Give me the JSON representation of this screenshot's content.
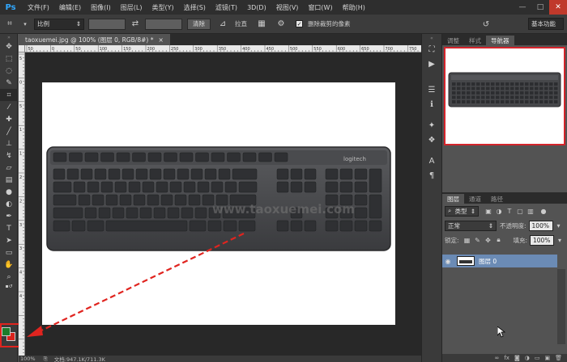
{
  "app": {
    "logo": "Ps"
  },
  "menu": [
    "文件(F)",
    "编辑(E)",
    "图像(I)",
    "图层(L)",
    "类型(Y)",
    "选择(S)",
    "滤镜(T)",
    "3D(D)",
    "视图(V)",
    "窗口(W)",
    "帮助(H)"
  ],
  "window_controls": {
    "minimize": "—",
    "maximize": "□",
    "close": "✕"
  },
  "options": {
    "ratio_label": "比例",
    "clear_label": "清除",
    "straighten_label": "拉直",
    "delete_cropped_label": "删除裁剪的像素",
    "delete_cropped_checked": true,
    "workspace_label": "基本功能"
  },
  "document": {
    "tab_title": "taoxuemei.jpg @ 100% (图层 0, RGB/8#) *",
    "tab_close": "×"
  },
  "ruler_h_ticks": [
    "50",
    "0",
    "50",
    "100",
    "150",
    "200",
    "250",
    "300",
    "350",
    "400",
    "450",
    "500",
    "550",
    "600",
    "650",
    "700",
    "750"
  ],
  "ruler_v_ticks": [
    "5",
    "0",
    "5",
    "1",
    "1",
    "2",
    "2",
    "3",
    "3",
    "4",
    "4"
  ],
  "keyboard": {
    "brand": "logitech",
    "watermark": "www.taoxuemei.com"
  },
  "status": {
    "zoom": "100%",
    "doc_info": "文档:947.1K/711.3K"
  },
  "right_panel": {
    "top_tabs": [
      "调整",
      "样式",
      "导航器"
    ],
    "layers_tabs": [
      "图层",
      "通道",
      "路径"
    ],
    "filter_kind": "类型",
    "blend_mode": "正常",
    "opacity_label": "不透明度:",
    "opacity_value": "100%",
    "lock_label": "锁定:",
    "fill_label": "填充:",
    "fill_value": "100%",
    "layer_name": "图层 0"
  },
  "colors": {
    "foreground": "#1c7c2a",
    "background": "#d9231d",
    "annotation_red": "#e0241f",
    "selected_layer": "#6b8bb5"
  }
}
